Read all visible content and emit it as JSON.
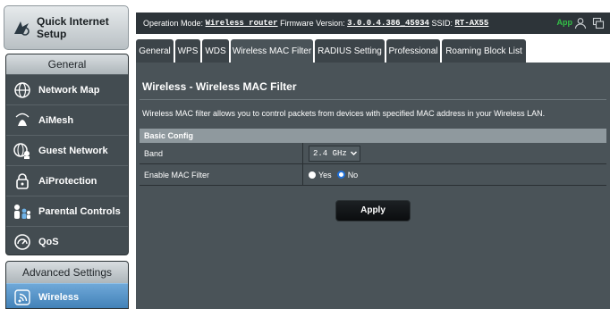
{
  "sidebar": {
    "quick_setup": {
      "label": "Quick Internet Setup",
      "icon": "quick-setup-icon"
    },
    "general_heading": "General",
    "items": [
      {
        "label": "Network Map",
        "icon": "globe-icon"
      },
      {
        "label": "AiMesh",
        "icon": "mesh-icon"
      },
      {
        "label": "Guest Network",
        "icon": "guest-network-icon"
      },
      {
        "label": "AiProtection",
        "icon": "padlock-icon"
      },
      {
        "label": "Parental Controls",
        "icon": "family-icon"
      },
      {
        "label": "QoS",
        "icon": "gauge-icon"
      }
    ],
    "advanced_heading": "Advanced Settings",
    "advanced_items": [
      {
        "label": "Wireless",
        "icon": "wifi-icon",
        "active": true
      }
    ]
  },
  "topbar": {
    "op_mode_label": "Operation Mode:",
    "op_mode_value": "Wireless router",
    "firmware_label": "Firmware Version:",
    "firmware_value": "3.0.0.4.386_45934",
    "ssid_label": "SSID:",
    "ssid_value": "RT-AX55",
    "app_label": "App",
    "icons": [
      "user-icon",
      "copy-icon"
    ]
  },
  "tabs": [
    {
      "label": "General",
      "active": false
    },
    {
      "label": "WPS",
      "active": false
    },
    {
      "label": "WDS",
      "active": false
    },
    {
      "label": "Wireless MAC Filter",
      "active": true
    },
    {
      "label": "RADIUS Setting",
      "active": false
    },
    {
      "label": "Professional",
      "active": false
    },
    {
      "label": "Roaming Block List",
      "active": false
    }
  ],
  "main": {
    "title": "Wireless - Wireless MAC Filter",
    "description": "Wireless MAC filter allows you to control packets from devices with specified MAC address in your Wireless LAN.",
    "basic_config": {
      "heading": "Basic Config",
      "band_label": "Band",
      "band_value": "2.4 GHz",
      "enable_label": "Enable MAC Filter",
      "options": [
        "Yes",
        "No"
      ],
      "selected": "No"
    },
    "apply_label": "Apply"
  },
  "colors": {
    "panel": "#4a5358",
    "topbar": "#2d3439",
    "active_item": "#4f8fc6",
    "app_green": "#33c047",
    "radio_selected": "#1e6fd9"
  }
}
